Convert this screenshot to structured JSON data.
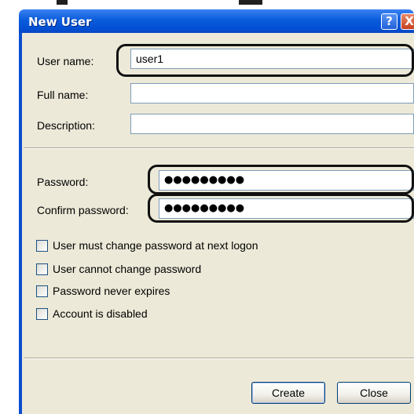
{
  "window": {
    "title": "New User",
    "help_glyph": "?",
    "close_glyph": "X"
  },
  "fields": {
    "username_label": "User name:",
    "username_value": "user1",
    "fullname_label": "Full name:",
    "fullname_value": "",
    "description_label": "Description:",
    "description_value": "",
    "password_label": "Password:",
    "password_value": "●●●●●●●●●",
    "confirm_label": "Confirm password:",
    "confirm_value": "●●●●●●●●●"
  },
  "options": [
    {
      "label": "User must change password at next logon",
      "checked": false
    },
    {
      "label": "User cannot change password",
      "checked": false
    },
    {
      "label": "Password never expires",
      "checked": false
    },
    {
      "label": "Account is disabled",
      "checked": false
    }
  ],
  "buttons": {
    "create_label": "Create",
    "close_label": "Close"
  },
  "colors": {
    "titlebar": "#0a5cdc",
    "dialog_bg": "#ece9d8",
    "textbox_border": "#7f9db9",
    "highlight_outline": "#111111"
  },
  "icons": {
    "help": "help-icon",
    "close": "close-icon"
  }
}
